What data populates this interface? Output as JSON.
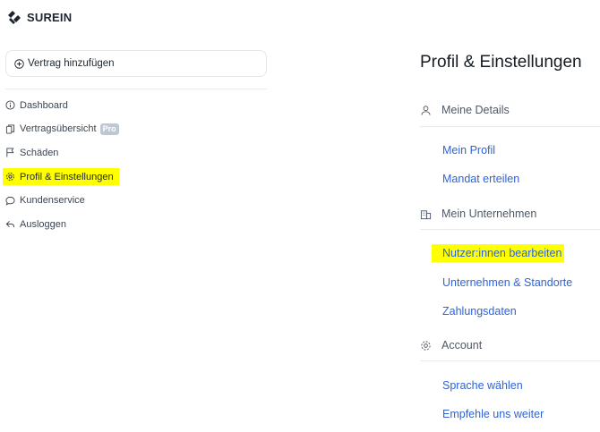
{
  "logo": {
    "text": "SUREIN"
  },
  "sidebar": {
    "add_button_label": "Vertrag hinzufügen",
    "items": [
      {
        "label": "Dashboard",
        "icon": "info-circle-icon"
      },
      {
        "label": "Vertragsübersicht",
        "icon": "documents-icon",
        "badge": "Pro"
      },
      {
        "label": "Schäden",
        "icon": "flag-icon"
      },
      {
        "label": "Profil & Einstellungen",
        "icon": "gear-icon",
        "active": true
      },
      {
        "label": "Kundenservice",
        "icon": "chat-bubble-icon"
      },
      {
        "label": "Ausloggen",
        "icon": "logout-icon"
      }
    ]
  },
  "main": {
    "title": "Profil & Einstellungen",
    "sections": [
      {
        "heading": "Meine Details",
        "icon": "user-icon",
        "links": [
          "Mein Profil",
          "Mandat erteilen"
        ]
      },
      {
        "heading": "Mein Unternehmen",
        "icon": "building-icon",
        "links": [
          "Nutzer:innen bearbeiten",
          "Unternehmen & Standorte",
          "Zahlungsdaten"
        ]
      },
      {
        "heading": "Account",
        "icon": "gear-icon",
        "links": [
          "Sprache wählen",
          "Empfehle uns weiter"
        ]
      }
    ]
  },
  "colors": {
    "link": "#2f63d6",
    "highlight": "#ffff00",
    "badge": "#bfc7d2"
  }
}
